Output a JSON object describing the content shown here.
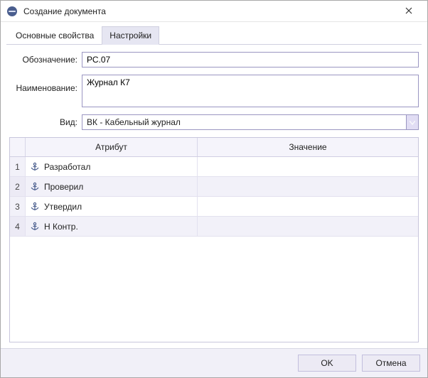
{
  "window": {
    "title": "Создание документа"
  },
  "tabs": [
    {
      "label": "Основные свойства",
      "active": false
    },
    {
      "label": "Настройки",
      "active": true
    }
  ],
  "form": {
    "designation_label": "Обозначение:",
    "designation_value": "РС.07",
    "name_label": "Наименование:",
    "name_value": "Журнал К7",
    "kind_label": "Вид:",
    "kind_value": "ВК - Кабельный журнал"
  },
  "grid": {
    "header_attr": "Атрибут",
    "header_val": "Значение",
    "rows": [
      {
        "n": "1",
        "attr": "Разработал",
        "val": ""
      },
      {
        "n": "2",
        "attr": "Проверил",
        "val": ""
      },
      {
        "n": "3",
        "attr": "Утвердил",
        "val": ""
      },
      {
        "n": "4",
        "attr": "Н Контр.",
        "val": ""
      }
    ]
  },
  "buttons": {
    "ok": "OK",
    "cancel": "Отмена"
  }
}
